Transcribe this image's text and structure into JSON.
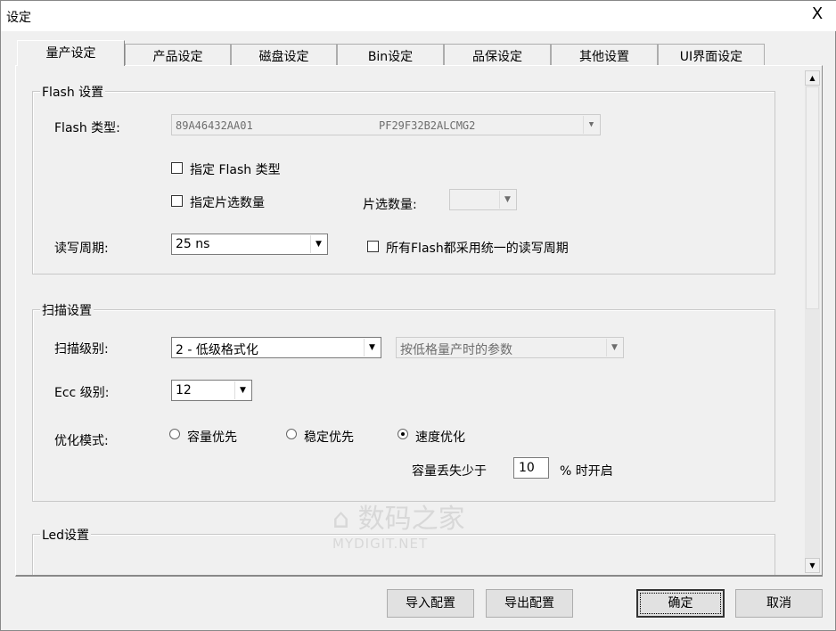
{
  "window": {
    "title": "设定",
    "close": "X"
  },
  "tabs": [
    {
      "label": "量产设定",
      "active": true
    },
    {
      "label": "产品设定"
    },
    {
      "label": "磁盘设定"
    },
    {
      "label": "Bin设定"
    },
    {
      "label": "品保设定"
    },
    {
      "label": "其他设置"
    },
    {
      "label": "UI界面设定"
    }
  ],
  "flash": {
    "group": "Flash 设置",
    "type_label": "Flash 类型:",
    "type_value1": "89A46432AA01",
    "type_value2": "PF29F32B2ALCMG2",
    "specify_type": {
      "label": "指定 Flash 类型",
      "checked": false
    },
    "specify_ce": {
      "label": "指定片选数量",
      "checked": false
    },
    "ce_label": "片选数量:",
    "ce_value": "",
    "cycle_label": "读写周期:",
    "cycle_value": "25 ns",
    "uniform_cycle": {
      "label": "所有Flash都采用统一的读写周期",
      "checked": false
    }
  },
  "scan": {
    "group": "扫描设置",
    "level_label": "扫描级别:",
    "level_value": "2 - 低级格式化",
    "level_param": "按低格量产时的参数",
    "ecc_label": "Ecc 级别:",
    "ecc_value": "12",
    "mode_label": "优化模式:",
    "modes": [
      {
        "label": "容量优先",
        "selected": false
      },
      {
        "label": "稳定优先",
        "selected": false
      },
      {
        "label": "速度优化",
        "selected": true
      }
    ],
    "loss_label": "容量丢失少于",
    "loss_value": "10",
    "loss_suffix": "% 时开启"
  },
  "led": {
    "group": "Led设置"
  },
  "buttons": {
    "import": "导入配置",
    "export": "导出配置",
    "ok": "确定",
    "cancel": "取消"
  },
  "scrollbar": {
    "up": "▲",
    "down": "▼"
  },
  "watermark": {
    "cn": "数码之家",
    "en": "MYDIGIT.NET"
  }
}
